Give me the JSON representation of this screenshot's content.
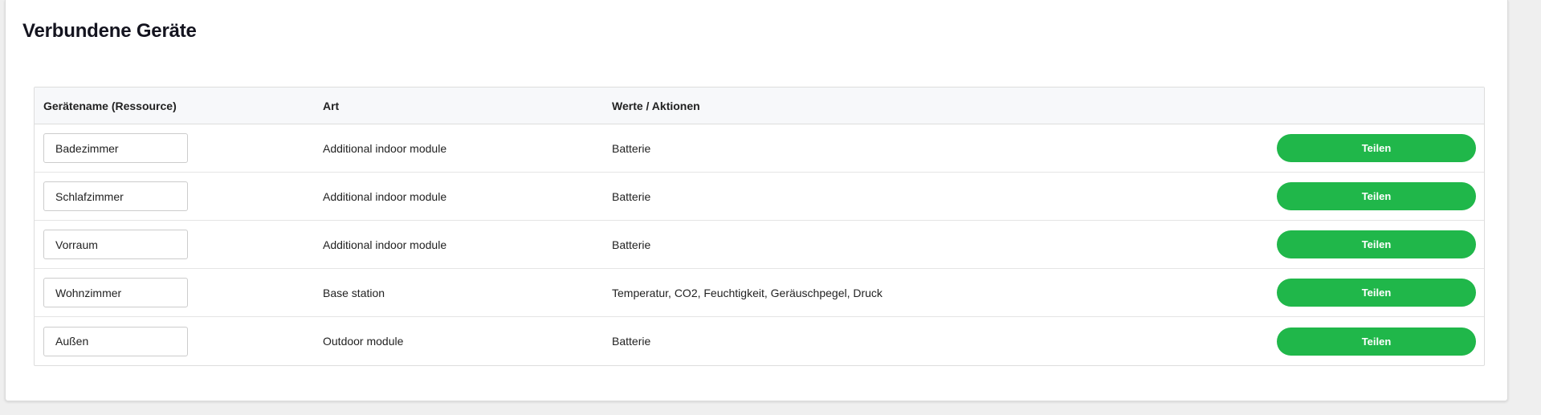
{
  "page": {
    "title": "Verbundene Geräte"
  },
  "table": {
    "headers": {
      "name": "Gerätename (Ressource)",
      "type": "Art",
      "values": "Werte / Aktionen",
      "action": ""
    },
    "rows": [
      {
        "name": "Badezimmer",
        "type": "Additional indoor module",
        "values": "Batterie",
        "button": "Teilen"
      },
      {
        "name": "Schlafzimmer",
        "type": "Additional indoor module",
        "values": "Batterie",
        "button": "Teilen"
      },
      {
        "name": "Vorraum",
        "type": "Additional indoor module",
        "values": "Batterie",
        "button": "Teilen"
      },
      {
        "name": "Wohnzimmer",
        "type": "Base station",
        "values": "Temperatur, CO2, Feuchtigkeit, Geräuschpegel, Druck",
        "button": "Teilen"
      },
      {
        "name": "Außen",
        "type": "Outdoor module",
        "values": "Batterie",
        "button": "Teilen"
      }
    ]
  },
  "colors": {
    "share_button": "#20b74a",
    "header_bg": "#f7f8fa"
  }
}
